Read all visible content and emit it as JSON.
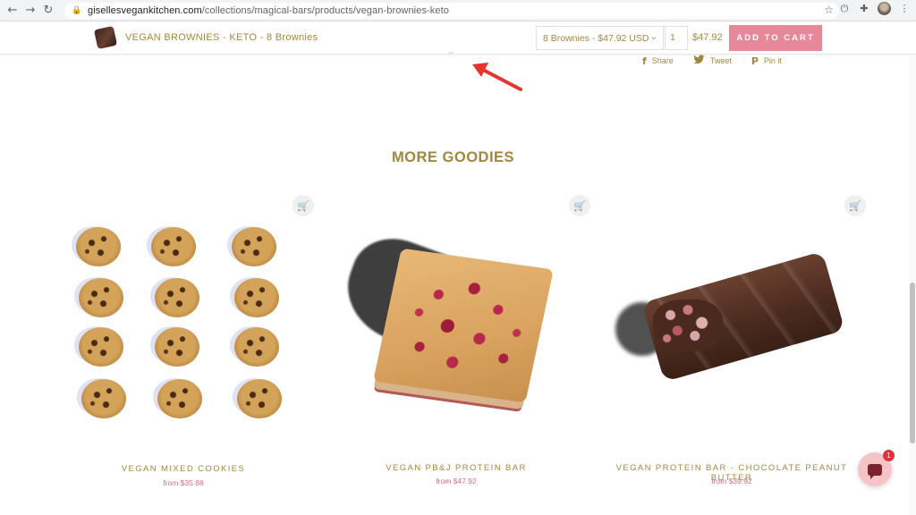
{
  "browser": {
    "url_domain": "gisellesvegankitchen.com",
    "url_path": "/collections/magical-bars/products/vegan-brownies-keto",
    "back_icon": "←",
    "forward_icon": "→",
    "reload_icon": "↻",
    "lock_icon": "🔒",
    "star_icon": "☆",
    "power_icon": "⏻",
    "extensions_icon": "✚",
    "menu_icon": "⋮"
  },
  "sticky_bar": {
    "title": "VEGAN BROWNIES - KETO - 8 Brownies",
    "variant": "8 Brownies - $47.92 USD",
    "variant_chevron": "⌄",
    "quantity": "1",
    "price": "$47.92",
    "add_to_cart": "ADD TO CART"
  },
  "share": {
    "share_icon": "f",
    "share_label": "Share",
    "tweet_icon": "🐦",
    "tweet_label": "Tweet",
    "pin_icon": "P",
    "pin_label": "Pin it"
  },
  "section": {
    "title": "MORE GOODIES"
  },
  "products": [
    {
      "name": "VEGAN MIXED COOKIES",
      "price": "from $35.88",
      "cart_icon": "🛒"
    },
    {
      "name": "VEGAN PB&J PROTEIN BAR",
      "price": "from $47.92",
      "cart_icon": "🛒"
    },
    {
      "name": "VEGAN PROTEIN BAR - CHOCOLATE PEANUT BUTTER",
      "price": "from $39.92",
      "cart_icon": "🛒"
    }
  ],
  "chat": {
    "badge": "1"
  },
  "colors": {
    "gold": "#a0883f",
    "pink_button": "#e6889a",
    "price_pink": "#d76e84",
    "arrow_red": "#e8332c"
  }
}
